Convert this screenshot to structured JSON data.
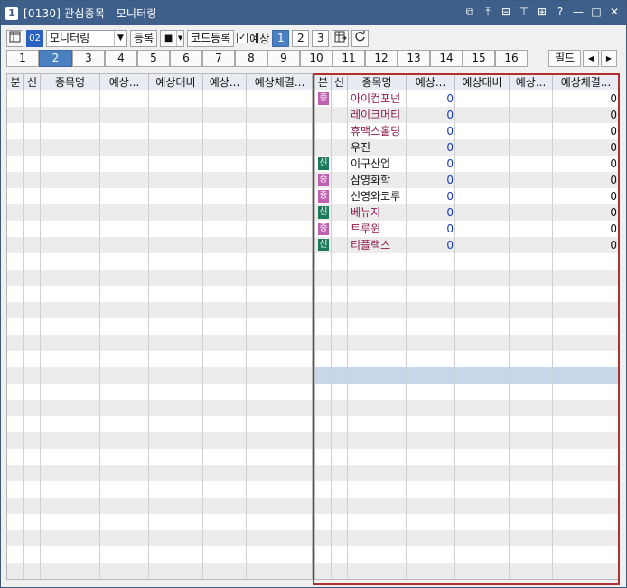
{
  "window": {
    "number": "1",
    "title": "[0130] 관심종목 - 모니터링"
  },
  "title_icons": [
    "link-icon",
    "pin-top-icon",
    "settings-window-icon",
    "pushpin-icon",
    "grid-icon",
    "help-icon",
    "minimize-icon",
    "maximize-icon",
    "close-icon"
  ],
  "title_glyphs": [
    "⧉",
    "⤒",
    "⊟",
    "⊤",
    "⊞",
    "?",
    "—",
    "□",
    "✕"
  ],
  "toolbar": {
    "group_badge": "02",
    "group_select": "모니터링",
    "register_label": "등록",
    "stop_symbol": "■",
    "code_register_label": "코드등록",
    "expect_checkbox_checked": true,
    "expect_label": "예상",
    "pages": [
      "1",
      "2",
      "3"
    ],
    "active_page": "1"
  },
  "tabs": {
    "items": [
      "1",
      "2",
      "3",
      "4",
      "5",
      "6",
      "7",
      "8",
      "9",
      "10",
      "11",
      "12",
      "13",
      "14",
      "15",
      "16"
    ],
    "active": "2",
    "field_label": "필드",
    "prev_arrow": "◀",
    "next_arrow": "▶"
  },
  "left_grid": {
    "columns": [
      "분",
      "신",
      "종목명",
      "예상...",
      "예상대비",
      "예상...",
      "예상체결..."
    ]
  },
  "right_grid": {
    "columns": [
      "분",
      "신",
      "종목명",
      "예상...",
      "예상대비",
      "예상...",
      "예상체결..."
    ],
    "rows": [
      {
        "badge": "증",
        "badge_color": "#c060b0",
        "name": "아이컴포넌",
        "name_color": "#8a1a4a",
        "v1": "0",
        "v2": "0"
      },
      {
        "badge": "",
        "badge_color": "",
        "name": "레이크머티",
        "name_color": "#8a1a4a",
        "v1": "0",
        "v2": "0"
      },
      {
        "badge": "",
        "badge_color": "",
        "name": "휴맥스홀딩",
        "name_color": "#8a1a4a",
        "v1": "0",
        "v2": "0"
      },
      {
        "badge": "",
        "badge_color": "",
        "name": "우진",
        "name_color": "#111111",
        "v1": "0",
        "v2": "0"
      },
      {
        "badge": "신",
        "badge_color": "#1a7a5a",
        "name": "이구산업",
        "name_color": "#111111",
        "v1": "0",
        "v2": "0"
      },
      {
        "badge": "증",
        "badge_color": "#c060b0",
        "name": "삼영화학",
        "name_color": "#111111",
        "v1": "0",
        "v2": "0"
      },
      {
        "badge": "증",
        "badge_color": "#c060b0",
        "name": "신영와코루",
        "name_color": "#111111",
        "v1": "0",
        "v2": "0"
      },
      {
        "badge": "신",
        "badge_color": "#1a7a5a",
        "name": "베뉴지",
        "name_color": "#8a1a4a",
        "v1": "0",
        "v2": "0"
      },
      {
        "badge": "증",
        "badge_color": "#c060b0",
        "name": "트루윈",
        "name_color": "#8a1a4a",
        "v1": "0",
        "v2": "0"
      },
      {
        "badge": "신",
        "badge_color": "#1a7a5a",
        "name": "티플랙스",
        "name_color": "#8a1a4a",
        "v1": "0",
        "v2": "0"
      }
    ],
    "value_color": "#1a3ab0"
  }
}
